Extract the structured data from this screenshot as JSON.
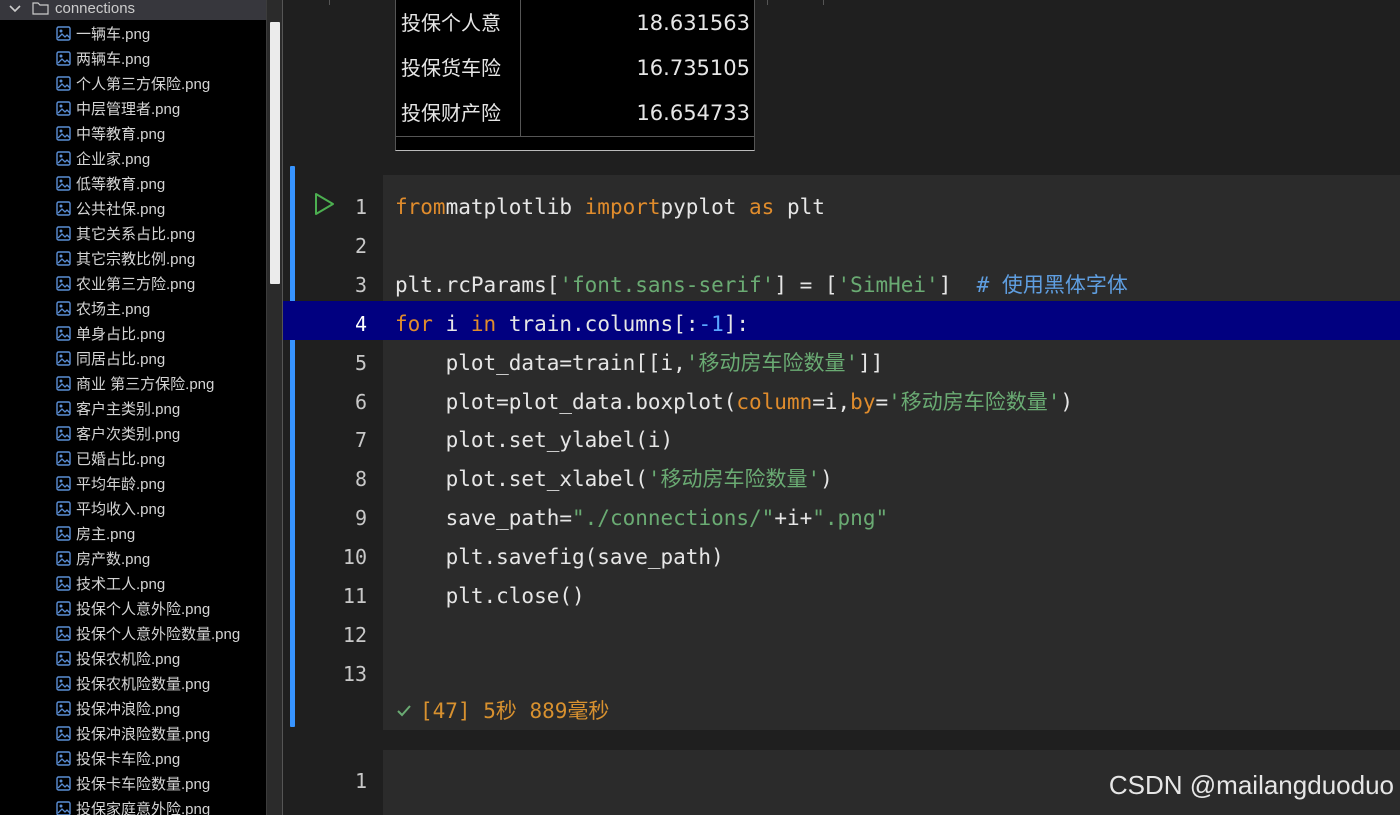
{
  "explorer": {
    "folder_name": "connections",
    "files": [
      "一辆车.png",
      "两辆车.png",
      "个人第三方保险.png",
      "中层管理者.png",
      "中等教育.png",
      "企业家.png",
      "低等教育.png",
      "公共社保.png",
      "其它关系占比.png",
      "其它宗教比例.png",
      "农业第三方险.png",
      "农场主.png",
      "单身占比.png",
      "同居占比.png",
      "商业 第三方保险.png",
      "客户主类别.png",
      "客户次类别.png",
      "已婚占比.png",
      "平均年龄.png",
      "平均收入.png",
      "房主.png",
      "房产数.png",
      "技术工人.png",
      "投保个人意外险.png",
      "投保个人意外险数量.png",
      "投保农机险.png",
      "投保农机险数量.png",
      "投保冲浪险.png",
      "投保冲浪险数量.png",
      "投保卡车险.png",
      "投保卡车险数量.png",
      "投保家庭意外险.png"
    ]
  },
  "output_table": {
    "rows": [
      {
        "label": "投保个人意",
        "value": "18.631563"
      },
      {
        "label": "投保货车险",
        "value": "16.735105"
      },
      {
        "label": "投保财产险",
        "value": "16.654733"
      }
    ]
  },
  "code_cell": {
    "active_line": "4",
    "lines": [
      {
        "n": "1",
        "tokens": [
          [
            "kw",
            "from"
          ],
          [
            "",
            "matplotlib "
          ],
          [
            "kw",
            "import"
          ],
          [
            "",
            ""
          ],
          [
            "",
            "pyplot "
          ],
          [
            "kw",
            "as"
          ],
          [
            "",
            " plt"
          ]
        ]
      },
      {
        "n": "2",
        "tokens": []
      },
      {
        "n": "3",
        "tokens": [
          [
            "",
            "plt.rcParams["
          ],
          [
            "str",
            "'font.sans-serif'"
          ],
          [
            "",
            "] = ["
          ],
          [
            "str",
            "'SimHei'"
          ],
          [
            "",
            "]  "
          ],
          [
            "cmt",
            "# 使用黑体字体"
          ]
        ]
      },
      {
        "n": "4",
        "tokens": [
          [
            "kw",
            "for"
          ],
          [
            "",
            " i "
          ],
          [
            "kw",
            "in"
          ],
          [
            "",
            " train.columns[:"
          ],
          [
            "num",
            "-1"
          ],
          [
            "",
            "]:"
          ]
        ]
      },
      {
        "n": "5",
        "tokens": [
          [
            "",
            "    plot_data=train[[i,"
          ],
          [
            "str",
            "'移动房车险数量'"
          ],
          [
            "",
            "]]"
          ]
        ]
      },
      {
        "n": "6",
        "tokens": [
          [
            "",
            "    plot=plot_data.boxplot("
          ],
          [
            "par",
            "column"
          ],
          [
            "",
            "=i,"
          ],
          [
            "par",
            "by"
          ],
          [
            "",
            "="
          ],
          [
            "str",
            "'移动房车险数量'"
          ],
          [
            "",
            ")"
          ]
        ]
      },
      {
        "n": "7",
        "tokens": [
          [
            "",
            "    plot.set_ylabel(i)"
          ]
        ]
      },
      {
        "n": "8",
        "tokens": [
          [
            "",
            "    plot.set_xlabel("
          ],
          [
            "str",
            "'移动房车险数量'"
          ],
          [
            "",
            ")"
          ]
        ]
      },
      {
        "n": "9",
        "tokens": [
          [
            "",
            "    save_path="
          ],
          [
            "str",
            "\"./connections/\""
          ],
          [
            "",
            "+i+"
          ],
          [
            "str",
            "\".png\""
          ]
        ]
      },
      {
        "n": "10",
        "tokens": [
          [
            "",
            "    plt.savefig(save_path)"
          ]
        ]
      },
      {
        "n": "11",
        "tokens": [
          [
            "",
            "    plt.close()"
          ]
        ]
      },
      {
        "n": "12",
        "tokens": []
      },
      {
        "n": "13",
        "tokens": []
      }
    ],
    "status": "[47] 5秒 889毫秒"
  },
  "next_cell": {
    "line_number": "1"
  },
  "watermark": "CSDN @mailangduoduo",
  "colors": {
    "keyword": "#e08c2c",
    "string": "#6aab73",
    "comment": "#5f9ee0",
    "number": "#5aa6ff",
    "active_line_bg": "#010080",
    "cell_bar": "#3794ff",
    "run_icon": "#4caf50"
  },
  "icons": {
    "folder": "folder-icon",
    "chevron": "chevron-down-icon",
    "file": "image-file-icon",
    "run": "run-cell-icon",
    "check": "check-icon"
  }
}
